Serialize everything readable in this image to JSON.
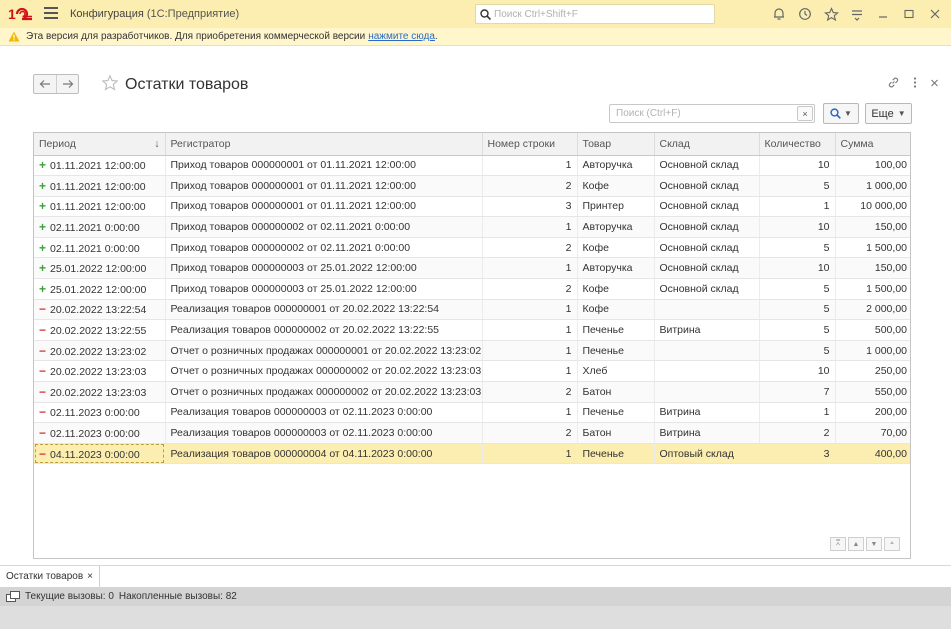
{
  "app": {
    "title": "Конфигурация",
    "subtitle": "(1С:Предприятие)",
    "search_placeholder": "Поиск Ctrl+Shift+F"
  },
  "warning": {
    "text": "Эта версия для разработчиков. Для приобретения коммерческой версии",
    "link": "нажмите сюда",
    "suffix": "."
  },
  "form": {
    "title": "Остатки товаров",
    "search_placeholder": "Поиск (Ctrl+F)",
    "clear_label": "×",
    "more_label": "Еще"
  },
  "table": {
    "columns": [
      "Период",
      "Регистратор",
      "Номер строки",
      "Товар",
      "Склад",
      "Количество",
      "Сумма"
    ],
    "rows": [
      {
        "sign": "+",
        "period": "01.11.2021 12:00:00",
        "registrar": "Приход товаров 000000001 от 01.11.2021 12:00:00",
        "line": "1",
        "product": "Авторучка",
        "warehouse": "Основной склад",
        "qty": "10",
        "sum": "100,00"
      },
      {
        "sign": "+",
        "period": "01.11.2021 12:00:00",
        "registrar": "Приход товаров 000000001 от 01.11.2021 12:00:00",
        "line": "2",
        "product": "Кофе",
        "warehouse": "Основной склад",
        "qty": "5",
        "sum": "1 000,00"
      },
      {
        "sign": "+",
        "period": "01.11.2021 12:00:00",
        "registrar": "Приход товаров 000000001 от 01.11.2021 12:00:00",
        "line": "3",
        "product": "Принтер",
        "warehouse": "Основной склад",
        "qty": "1",
        "sum": "10 000,00"
      },
      {
        "sign": "+",
        "period": "02.11.2021 0:00:00",
        "registrar": "Приход товаров 000000002 от 02.11.2021 0:00:00",
        "line": "1",
        "product": "Авторучка",
        "warehouse": "Основной склад",
        "qty": "10",
        "sum": "150,00"
      },
      {
        "sign": "+",
        "period": "02.11.2021 0:00:00",
        "registrar": "Приход товаров 000000002 от 02.11.2021 0:00:00",
        "line": "2",
        "product": "Кофе",
        "warehouse": "Основной склад",
        "qty": "5",
        "sum": "1 500,00"
      },
      {
        "sign": "+",
        "period": "25.01.2022 12:00:00",
        "registrar": "Приход товаров 000000003 от 25.01.2022 12:00:00",
        "line": "1",
        "product": "Авторучка",
        "warehouse": "Основной склад",
        "qty": "10",
        "sum": "150,00"
      },
      {
        "sign": "+",
        "period": "25.01.2022 12:00:00",
        "registrar": "Приход товаров 000000003 от 25.01.2022 12:00:00",
        "line": "2",
        "product": "Кофе",
        "warehouse": "Основной склад",
        "qty": "5",
        "sum": "1 500,00"
      },
      {
        "sign": "−",
        "period": "20.02.2022 13:22:54",
        "registrar": "Реализация товаров 000000001 от 20.02.2022 13:22:54",
        "line": "1",
        "product": "Кофе",
        "warehouse": "",
        "qty": "5",
        "sum": "2 000,00"
      },
      {
        "sign": "−",
        "period": "20.02.2022 13:22:55",
        "registrar": "Реализация товаров 000000002 от 20.02.2022 13:22:55",
        "line": "1",
        "product": "Печенье",
        "warehouse": "Витрина",
        "qty": "5",
        "sum": "500,00"
      },
      {
        "sign": "−",
        "period": "20.02.2022 13:23:02",
        "registrar": "Отчет о розничных продажах 000000001 от 20.02.2022 13:23:02",
        "line": "1",
        "product": "Печенье",
        "warehouse": "",
        "qty": "5",
        "sum": "1 000,00"
      },
      {
        "sign": "−",
        "period": "20.02.2022 13:23:03",
        "registrar": "Отчет о розничных продажах 000000002 от 20.02.2022 13:23:03",
        "line": "1",
        "product": "Хлеб",
        "warehouse": "",
        "qty": "10",
        "sum": "250,00"
      },
      {
        "sign": "−",
        "period": "20.02.2022 13:23:03",
        "registrar": "Отчет о розничных продажах 000000002 от 20.02.2022 13:23:03",
        "line": "2",
        "product": "Батон",
        "warehouse": "",
        "qty": "7",
        "sum": "550,00"
      },
      {
        "sign": "−",
        "period": "02.11.2023 0:00:00",
        "registrar": "Реализация товаров 000000003 от 02.11.2023 0:00:00",
        "line": "1",
        "product": "Печенье",
        "warehouse": "Витрина",
        "qty": "1",
        "sum": "200,00"
      },
      {
        "sign": "−",
        "period": "02.11.2023 0:00:00",
        "registrar": "Реализация товаров 000000003 от 02.11.2023 0:00:00",
        "line": "2",
        "product": "Батон",
        "warehouse": "Витрина",
        "qty": "2",
        "sum": "70,00"
      },
      {
        "sign": "−",
        "period": "04.11.2023 0:00:00",
        "registrar": "Реализация товаров 000000004 от 04.11.2023 0:00:00",
        "line": "1",
        "product": "Печенье",
        "warehouse": "Оптовый склад",
        "qty": "3",
        "sum": "400,00",
        "selected": true
      }
    ]
  },
  "open_tabs": [
    {
      "label": "Остатки товаров",
      "close": "×"
    }
  ],
  "status": {
    "current_calls": "Текущие вызовы: 0",
    "accumulated_calls": "Накопленные вызовы: 82"
  },
  "colors": {
    "titlebar": "#fbeeb0",
    "selected_row": "#fbeeb0",
    "plus": "#3ca03c",
    "minus": "#d03c3c",
    "link": "#2a6ac8"
  },
  "icons": [
    "1c-logo",
    "hamburger-menu-icon",
    "search-icon",
    "bell-icon",
    "history-icon",
    "star-icon",
    "settings-icon",
    "minimize-icon",
    "maximize-icon",
    "close-icon",
    "warning-icon",
    "back-arrow-icon",
    "forward-arrow-icon",
    "link-icon",
    "more-vertical-icon"
  ]
}
